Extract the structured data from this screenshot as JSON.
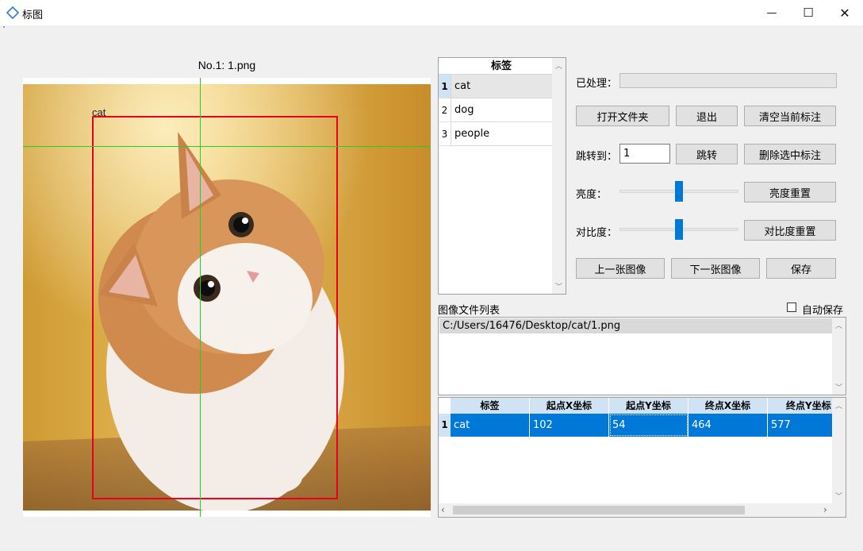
{
  "window": {
    "title": "标图",
    "minimize_glyph": "—",
    "maximize_glyph": "☐",
    "close_glyph": "✕"
  },
  "image_panel": {
    "name": "No.1: 1.png",
    "bbox_label": "cat"
  },
  "label_list": {
    "header": "标签",
    "rows": [
      {
        "index": "1",
        "label": "cat"
      },
      {
        "index": "2",
        "label": "dog"
      },
      {
        "index": "3",
        "label": "people"
      }
    ]
  },
  "controls": {
    "processed_label": "已处理：",
    "progress": 0,
    "open_folder": "打开文件夹",
    "exit": "退出",
    "clear_current": "清空当前标注",
    "jump_to_label": "跳转到：",
    "jump_value": "1",
    "jump_button": "跳转",
    "delete_selected": "删除选中标注",
    "brightness_label": "亮度：",
    "brightness_level": 0.5,
    "brightness_reset": "亮度重置",
    "contrast_label": "对比度：",
    "contrast_level": 0.5,
    "contrast_reset": "对比度重置",
    "prev_image": "上一张图像",
    "next_image": "下一张图像",
    "save": "保存"
  },
  "file_list": {
    "title": "图像文件列表",
    "autosave_label": "自动保存",
    "autosave_checked": false,
    "items": [
      "C:/Users/16476/Desktop/cat/1.png"
    ]
  },
  "annotation_table": {
    "headers": [
      "标签",
      "起点X坐标",
      "起点Y坐标",
      "终点X坐标",
      "终点Y坐标"
    ],
    "rows": [
      {
        "index": "1",
        "cells": [
          "cat",
          "102",
          "54",
          "464",
          "577"
        ]
      }
    ]
  },
  "colors": {
    "bbox": "#e8001c",
    "crosshair": "#22d022",
    "selection": "#0078d7",
    "header_bg": "#cfe3f4"
  }
}
